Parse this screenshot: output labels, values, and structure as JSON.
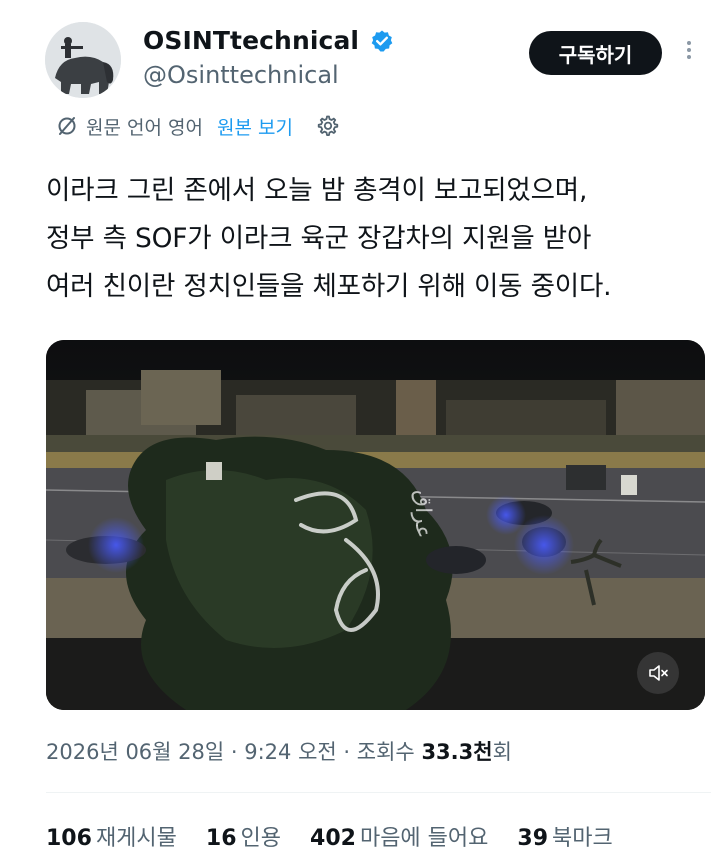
{
  "author": {
    "display_name": "OSINTtechnical",
    "handle": "@Osinttechnical"
  },
  "header": {
    "subscribe_label": "구독하기"
  },
  "translation": {
    "original_language": "원문 언어 영어",
    "view_original": "원본 보기"
  },
  "tweet": {
    "lines": [
      "이라크 그린 존에서 오늘 밤 총격이 보고되었으며,",
      "정부 측 SOF가 이라크 육군 장갑차의 지원을 받아",
      "여러 친이란 정치인들을 체포하기 위해 이동 중이다."
    ]
  },
  "media": {
    "watermark": "عراق"
  },
  "meta": {
    "date": "2026년 06월 28일",
    "time": "9:24 오전",
    "views_label": "조회수",
    "views_count": "33.3천",
    "views_suffix": "회"
  },
  "stats": [
    {
      "count": "106",
      "label": "재게시물"
    },
    {
      "count": "16",
      "label": "인용"
    },
    {
      "count": "402",
      "label": "마음에 들어요"
    },
    {
      "count": "39",
      "label": "북마크"
    }
  ],
  "colors": {
    "accent": "#1d9bf0",
    "text": "#0f1419",
    "muted": "#536471",
    "button_bg": "#0f1419"
  }
}
